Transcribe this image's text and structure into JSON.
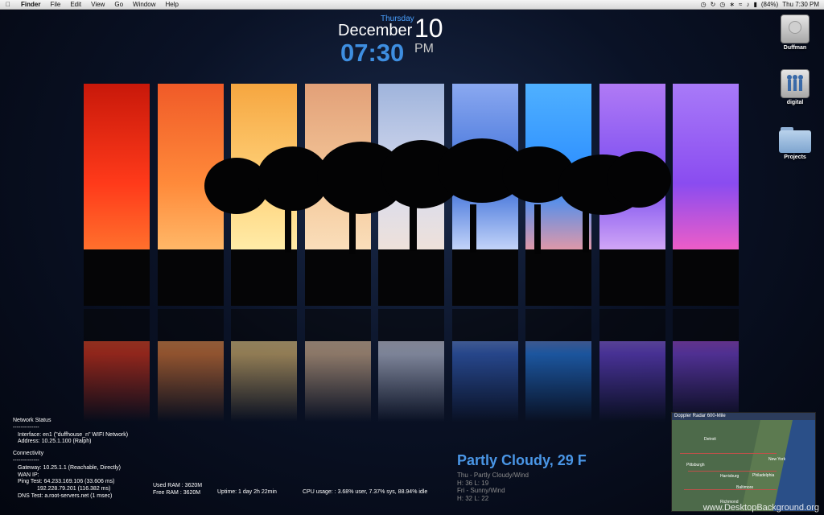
{
  "menubar": {
    "apple_icon": "apple-icon",
    "app": "Finder",
    "menus": [
      "File",
      "Edit",
      "View",
      "Go",
      "Window",
      "Help"
    ],
    "battery": "(84%)",
    "clock": "Thu 7:30 PM"
  },
  "clock_widget": {
    "day_of_week": "Thursday",
    "month": "December",
    "day": "10",
    "time": "07:30",
    "ampm": "PM"
  },
  "desktop_icons": [
    {
      "label": "Duffman",
      "icon": "hard-drive-icon"
    },
    {
      "label": "digital",
      "icon": "network-drive-icon"
    },
    {
      "label": "Projects",
      "icon": "folder-icon"
    }
  ],
  "network": {
    "title": "Network Status",
    "sep1": "--------------",
    "interface": "Interface: en1 (\"duffhouse_n\" WIFI Network)",
    "address": "Address:  10.25.1.100 (Ralph)",
    "connectivity": "Connectivity",
    "sep2": "--------------",
    "gateway": "Gateway:  10.25.1.1 (Reachable, Directly)",
    "wan": "WAN IP:",
    "ping1": "Ping Test: 64.233.169.106 (33.606 ms)",
    "ping2": "192.228.79.201 (116.382 ms)",
    "dns": "DNS Test:  a.root-servers.net (1 msec)"
  },
  "system": {
    "used_ram": "Used RAM : 3620M",
    "free_ram": "Free RAM : 3620M",
    "uptime": "Uptime: 1 day 2h 22min",
    "cpu": "CPU usage: : 3.68% user, 7.37% sys, 88.94% idle"
  },
  "weather": {
    "current": "Partly Cloudy, 29 F",
    "fc1": "Thu - Partly Cloudy/Wind",
    "fc2": "H: 36 L: 19",
    "fc3": "Fri - Sunny/Wind",
    "fc4": "H: 32 L: 22"
  },
  "radar": {
    "title": "Doppler Radar 600-Mile",
    "cities": [
      "Detroit",
      "Pittsburgh",
      "New York",
      "Philadelphia",
      "Baltimore",
      "Richmond",
      "Harrisburg"
    ]
  },
  "watermark": "www.DesktopBackground.org",
  "panel_colors": [
    [
      "#ff3a1a",
      "#c8180a",
      "#ff7a30"
    ],
    [
      "#ff8a3a",
      "#f05a28",
      "#ffc070"
    ],
    [
      "#ffd27a",
      "#f6a640",
      "#fff0b0"
    ],
    [
      "#f4c89a",
      "#e2a078",
      "#fbe2c0"
    ],
    [
      "#d8dcef",
      "#9fb4dc",
      "#f2e2d6"
    ],
    [
      "#3c6ed8",
      "#8aa8f0",
      "#dbe6ff"
    ],
    [
      "#2a8cff",
      "#4fb0ff",
      "#ff9a9a"
    ],
    [
      "#7a4cf0",
      "#b07af5",
      "#e0b6f7"
    ],
    [
      "#8a4cf0",
      "#a87af8",
      "#ff60c0"
    ]
  ]
}
